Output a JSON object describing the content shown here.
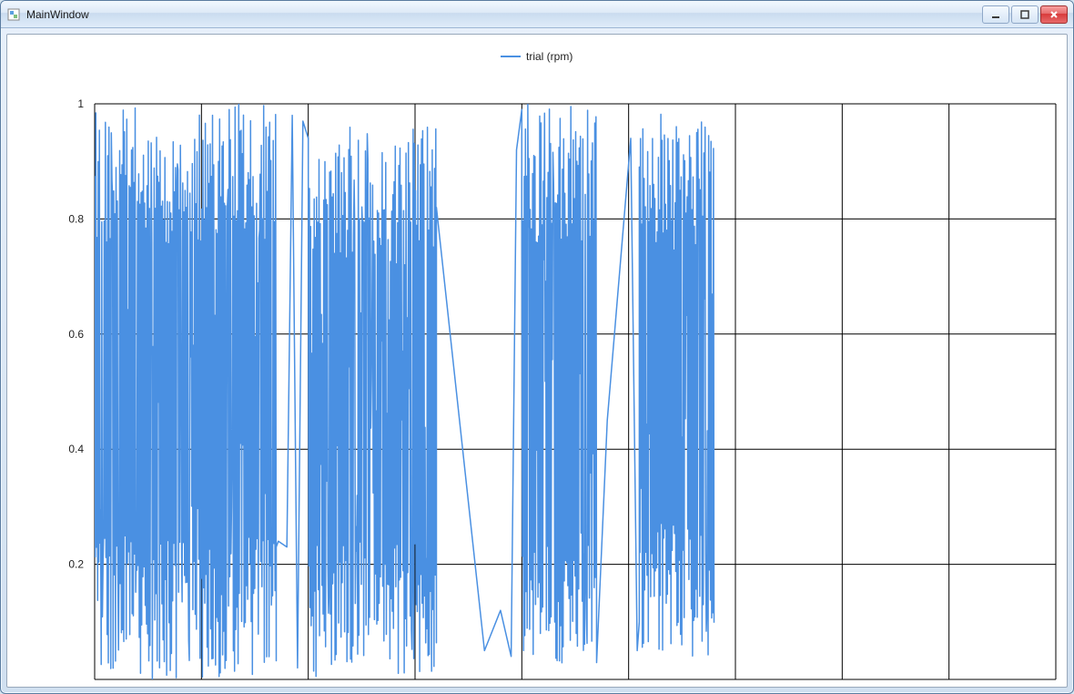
{
  "window": {
    "title": "MainWindow",
    "buttons": {
      "minimize": "Minimize",
      "maximize": "Maximize",
      "close": "Close"
    }
  },
  "chart_data": {
    "type": "line",
    "title": "",
    "legend": {
      "label": "trial (rpm)",
      "position": "top-center"
    },
    "xlabel": "",
    "ylabel": "",
    "ylim": [
      0,
      1
    ],
    "xlim": [
      0,
      9
    ],
    "y_ticks": [
      0.2,
      0.4,
      0.6,
      0.8,
      1
    ],
    "x_gridlines": [
      0,
      1,
      2,
      3,
      4,
      5,
      6,
      7,
      8,
      9
    ],
    "series": [
      {
        "name": "trial (rpm)",
        "color": "#4a90e2",
        "segments": [
          {
            "x_range": [
              0.0,
              1.7
            ],
            "description": "dense random oscillation across full range",
            "y_min": 0.0,
            "y_max": 1.0
          },
          {
            "x_range": [
              1.7,
              2.0
            ],
            "description": "sparse / short bridge",
            "bridge": [
              [
                1.7,
                0.23
              ],
              [
                1.72,
                0.24
              ],
              [
                1.8,
                0.23
              ],
              [
                1.85,
                0.98
              ],
              [
                1.9,
                0.02
              ],
              [
                1.95,
                0.97
              ],
              [
                2.0,
                0.94
              ]
            ]
          },
          {
            "x_range": [
              2.0,
              3.2
            ],
            "description": "dense random oscillation, slightly lower peaks",
            "y_min": 0.0,
            "y_max": 0.96
          },
          {
            "x_range": [
              3.2,
              4.0
            ],
            "description": "sparse diagonal down",
            "bridge": [
              [
                3.2,
                0.82
              ],
              [
                3.65,
                0.05
              ],
              [
                3.8,
                0.12
              ],
              [
                3.9,
                0.04
              ],
              [
                3.95,
                0.92
              ],
              [
                4.0,
                0.99
              ]
            ]
          },
          {
            "x_range": [
              4.0,
              4.7
            ],
            "description": "dense random oscillation",
            "y_min": 0.02,
            "y_max": 1.0
          },
          {
            "x_range": [
              4.7,
              5.1
            ],
            "description": "sparse diagonal up then drop",
            "bridge": [
              [
                4.7,
                0.03
              ],
              [
                4.8,
                0.45
              ],
              [
                5.02,
                0.94
              ],
              [
                5.08,
                0.05
              ],
              [
                5.1,
                0.1
              ]
            ]
          },
          {
            "x_range": [
              5.1,
              5.8
            ],
            "description": "dense random oscillation",
            "y_min": 0.04,
            "y_max": 0.99
          }
        ]
      }
    ]
  }
}
